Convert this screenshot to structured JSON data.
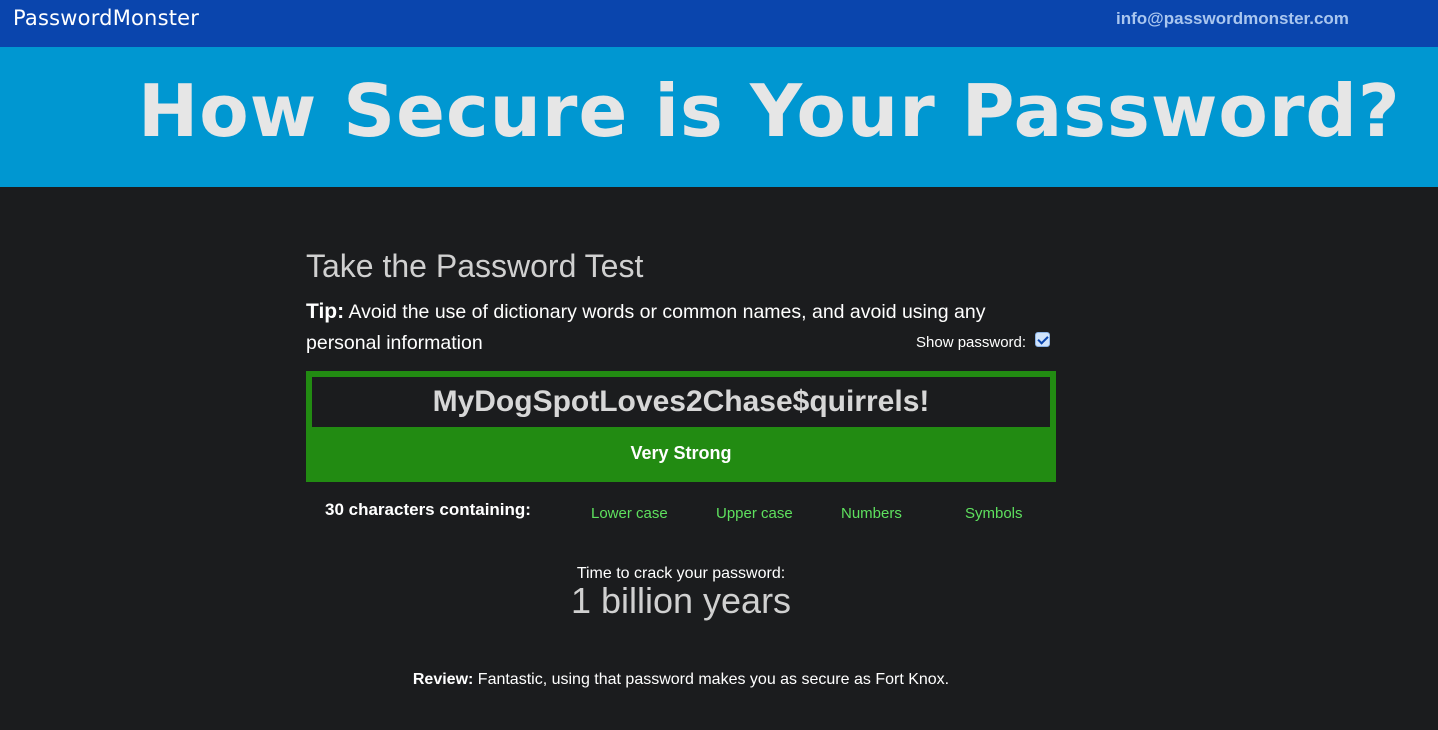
{
  "header": {
    "brand": "PasswordMonster",
    "email": "info@passwordmonster.com"
  },
  "hero": {
    "title": "How Secure is Your Password?"
  },
  "test": {
    "title": "Take the Password Test",
    "tip_label": "Tip:",
    "tip_text": " Avoid the use of dictionary words or common names, and avoid using any personal information",
    "show_password_label": "Show password:",
    "show_password_checked": true,
    "password_value": "MyDogSpotLoves2Chase$quirrels!",
    "strength_label": "Very Strong",
    "strength_color": "#228b12"
  },
  "analysis": {
    "characters_label": "30 characters containing:",
    "types": [
      "Lower case",
      "Upper case",
      "Numbers",
      "Symbols"
    ],
    "type_color": "#5ee05e"
  },
  "crack": {
    "label": "Time to crack your password:",
    "time": "1 billion years"
  },
  "review": {
    "label": "Review:",
    "text": " Fantastic, using that password makes you as secure as Fort Knox."
  }
}
